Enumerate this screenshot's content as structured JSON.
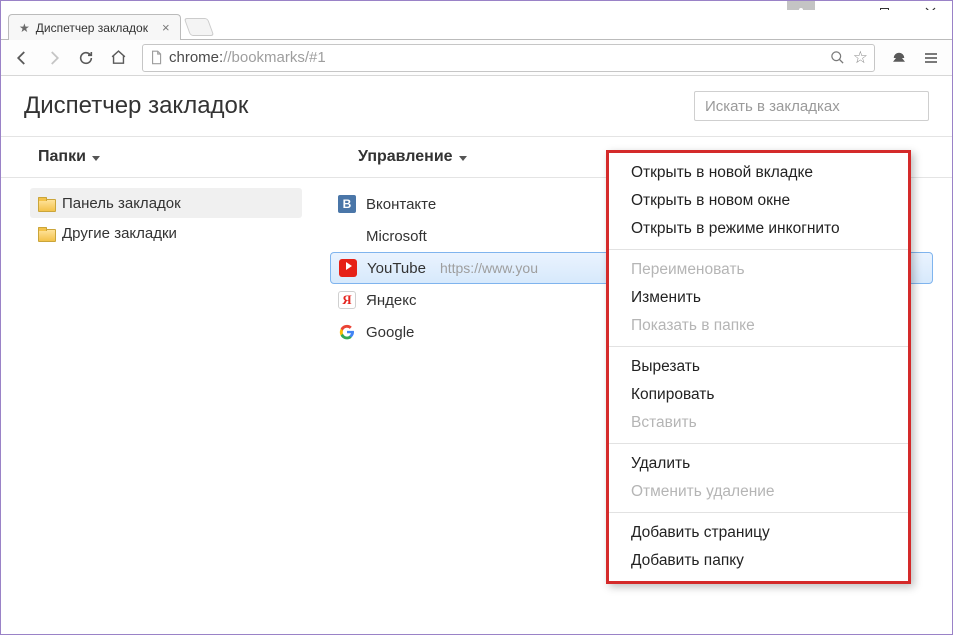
{
  "window": {
    "tab_title": "Диспетчер закладок",
    "address_proto": "chrome:",
    "address_rest": "//bookmarks/#1"
  },
  "header": {
    "title": "Диспетчер закладок",
    "search_placeholder": "Искать в закладках"
  },
  "columns": {
    "folders_label": "Папки",
    "manage_label": "Управление"
  },
  "folders": [
    {
      "label": "Панель закладок",
      "selected": true
    },
    {
      "label": "Другие закладки",
      "selected": false
    }
  ],
  "bookmarks": [
    {
      "label": "Вконтакте",
      "icon": "vk",
      "selected": false,
      "url": ""
    },
    {
      "label": "Microsoft",
      "icon": "ms",
      "selected": false,
      "url": ""
    },
    {
      "label": "YouTube",
      "icon": "yt",
      "selected": true,
      "url": "https://www.you"
    },
    {
      "label": "Яндекс",
      "icon": "ya",
      "selected": false,
      "url": ""
    },
    {
      "label": "Google",
      "icon": "g",
      "selected": false,
      "url": ""
    }
  ],
  "context_menu": [
    {
      "label": "Открыть в новой вкладке",
      "enabled": true
    },
    {
      "label": "Открыть в новом окне",
      "enabled": true
    },
    {
      "label": "Открыть в режиме инкогнито",
      "enabled": true
    },
    {
      "sep": true
    },
    {
      "label": "Переименовать",
      "enabled": false
    },
    {
      "label": "Изменить",
      "enabled": true
    },
    {
      "label": "Показать в папке",
      "enabled": false
    },
    {
      "sep": true
    },
    {
      "label": "Вырезать",
      "enabled": true
    },
    {
      "label": "Копировать",
      "enabled": true
    },
    {
      "label": "Вставить",
      "enabled": false
    },
    {
      "sep": true
    },
    {
      "label": "Удалить",
      "enabled": true
    },
    {
      "label": "Отменить удаление",
      "enabled": false
    },
    {
      "sep": true
    },
    {
      "label": "Добавить страницу",
      "enabled": true
    },
    {
      "label": "Добавить папку",
      "enabled": true
    }
  ]
}
